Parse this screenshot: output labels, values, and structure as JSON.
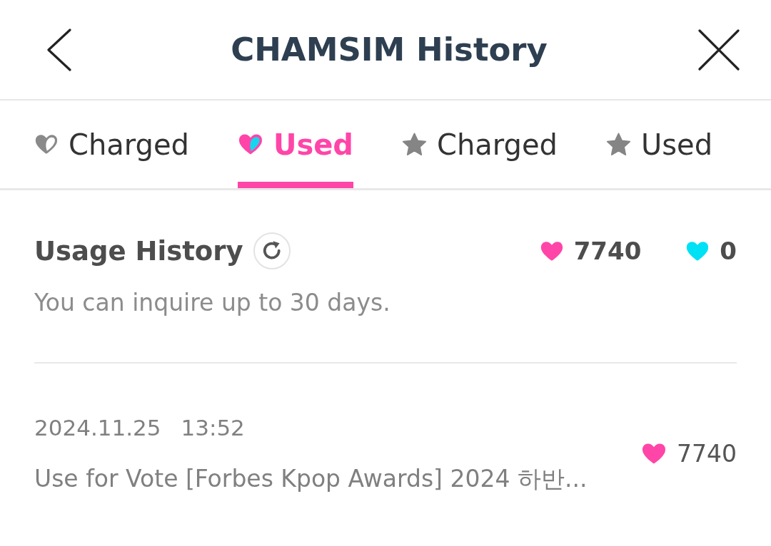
{
  "header": {
    "title": "CHAMSIM History"
  },
  "tabs": [
    {
      "label": "Charged",
      "kind": "heart-charged",
      "selected": false
    },
    {
      "label": "Used",
      "kind": "heart-used",
      "selected": true
    },
    {
      "label": "Charged",
      "kind": "star",
      "selected": false
    },
    {
      "label": "Used",
      "kind": "star",
      "selected": false
    }
  ],
  "summary": {
    "title": "Usage History",
    "note": "You can inquire up to 30 days.",
    "balances": [
      {
        "color": "#ff45a8",
        "amount": "7740"
      },
      {
        "color": "#00e1f5",
        "amount": "0"
      }
    ]
  },
  "history": [
    {
      "date": "2024.11.25",
      "time": "13:52",
      "description": "Use for Vote [Forbes Kpop Awards] 2024 하반...",
      "color": "#ff45a8",
      "amount": "7740"
    }
  ]
}
